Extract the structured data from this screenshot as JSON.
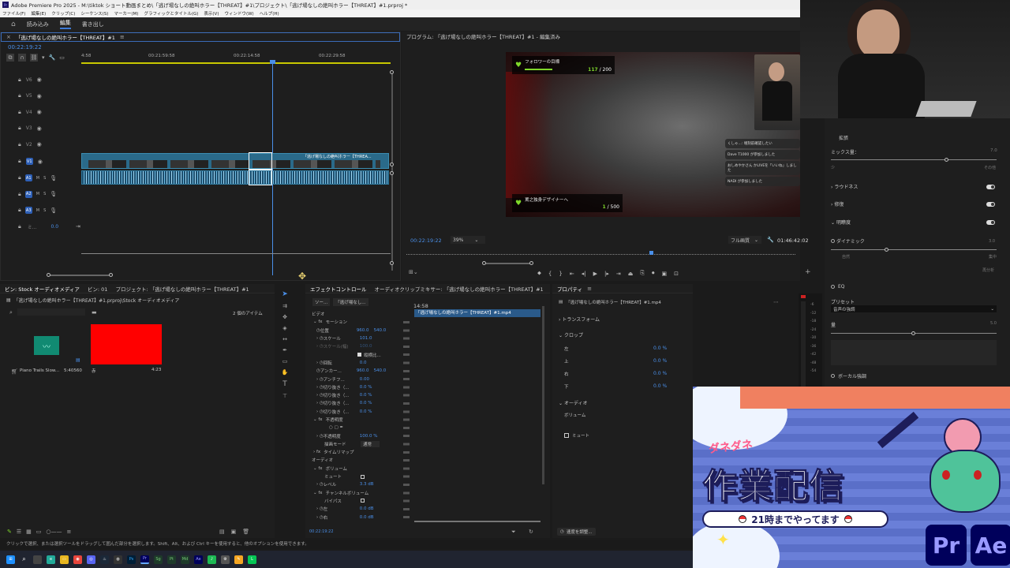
{
  "app": {
    "title": "Adobe Premiere Pro 2025 - M:\\tiktok ショート動画まとめ\\「逃げ場なしの絶叫ホラー【THREAT】#1\\プロジェクト\\「逃げ場なしの絶叫ホラー【THREAT】#1.prproj *"
  },
  "menu": [
    "ファイル(F)",
    "編集(E)",
    "クリップ(C)",
    "シーケンス(S)",
    "マーカー(M)",
    "グラフィックとタイトル(G)",
    "表示(V)",
    "ウィンドウ(W)",
    "ヘルプ(H)"
  ],
  "workspace": {
    "tabs": [
      "読み込み",
      "編集",
      "書き出し"
    ],
    "program_header": "プログラム: 「逃げ場なしの絶叫ホラー【THREAT】#1 - 編集済み"
  },
  "timeline": {
    "header": "「逃げ場なしの絶叫ホラー【THREAT】#1",
    "timecode": "00:22:19:22",
    "ruler": [
      "4:58",
      "00:21:59:58",
      "00:22:14:58",
      "00:22:29:58"
    ],
    "tracks": [
      {
        "id": "V6"
      },
      {
        "id": "V5"
      },
      {
        "id": "V4"
      },
      {
        "id": "V3"
      },
      {
        "id": "V2"
      },
      {
        "id": "V1"
      },
      {
        "id": "A1"
      },
      {
        "id": "A2"
      },
      {
        "id": "A3"
      }
    ],
    "mix_label": "ミ...",
    "mix_value": "0.0",
    "clip_label": "「逃げ場なしの絶叫ホラー【THREA..."
  },
  "program": {
    "timecode": "00:22:19:22",
    "zoom": "39%",
    "quality": "フル画質",
    "duration": "01:46:42:02",
    "overlay_top": {
      "label": "フォロワーの目標",
      "current": "117",
      "goal": "200"
    },
    "overlay_bottom": {
      "label": "罵之独身デザイナーへ",
      "current": "1",
      "goal": "500"
    },
    "chat": [
      "くしゃ...: 増刻前確認したい",
      "Dave T1000 が参加しました",
      "おしめやかさん かLIVEを「いいね」しました",
      "NADI が参加しました"
    ]
  },
  "source_panel": {
    "tabs": [
      "ビン: Stock オーディオメディア",
      "ビン: 01",
      "プロジェクト: 「逃げ場なしの絶叫ホラー【THREAT】#1",
      "オーディオクリップミキサー: 「逃げ場なしの絶叫ホラー【THREAT】#1"
    ],
    "path": "「逃げ場なしの絶叫ホラー【THREAT】#1.prproj\\Stock オーディオメディア",
    "item_count": "2 個のアイテム",
    "items": [
      {
        "name": "Piano Trails Slow...",
        "duration": "5:40560"
      },
      {
        "name": "赤",
        "duration": "4:23"
      }
    ]
  },
  "effects": {
    "tabs": [
      "ソー...",
      "「逃げ場なし..."
    ],
    "clip": "「逃げ場なしの絶叫ホラー【THREAT】#1.mp4",
    "mini_time": "14:58",
    "footer_time": "00:22:19:22",
    "sections": {
      "video": "ビデオ",
      "motion": "モーション",
      "opacity": "不透明度",
      "timeremap": "タイムリマップ",
      "audio": "オーディオ",
      "volume": "ボリューム",
      "channel_volume": "チャンネルボリューム"
    },
    "rows": [
      {
        "label": "位置",
        "v1": "960.0",
        "v2": "540.0"
      },
      {
        "label": "スケール",
        "v1": "101.0",
        "v2": ""
      },
      {
        "label": "スケール(幅)",
        "v1": "100.0",
        "v2": ""
      },
      {
        "label": "縦横比...",
        "v1": "",
        "v2": ""
      },
      {
        "label": "回転",
        "v1": "0.0",
        "v2": ""
      },
      {
        "label": "アンカー...",
        "v1": "960.0",
        "v2": "540.0"
      },
      {
        "label": "アンチフ...",
        "v1": "0.00",
        "v2": ""
      },
      {
        "label": "切り抜き（...",
        "v1": "0.0 %",
        "v2": ""
      },
      {
        "label": "切り抜き（...",
        "v1": "0.0 %",
        "v2": ""
      },
      {
        "label": "切り抜き（...",
        "v1": "0.0 %",
        "v2": ""
      },
      {
        "label": "切り抜き（...",
        "v1": "0.0 %",
        "v2": ""
      }
    ],
    "opacity_rows": [
      {
        "label": "不透明度",
        "v1": "100.0 %"
      },
      {
        "label": "描画モード",
        "v1": "通常"
      }
    ],
    "volume_rows": [
      {
        "label": "ミュート",
        "v1": ""
      },
      {
        "label": "レベル",
        "v1": "3.3 dB"
      }
    ],
    "channel_rows": [
      {
        "label": "バイパス",
        "v1": ""
      },
      {
        "label": "左",
        "v1": "0.0 dB"
      },
      {
        "label": "右",
        "v1": "0.0 dB"
      }
    ]
  },
  "properties": {
    "title": "プロパティ",
    "clip": "「逃げ場なしの絶叫ホラー【THREAT】#1.mp4",
    "transform": "トランスフォーム",
    "crop": "クロップ",
    "crop_rows": [
      {
        "label": "左",
        "value": "0.0 %"
      },
      {
        "label": "上",
        "value": "0.0 %"
      },
      {
        "label": "右",
        "value": "0.0 %"
      },
      {
        "label": "下",
        "value": "0.0 %"
      }
    ],
    "audio": "オーディオ",
    "volume": "ボリューム",
    "mute": "ミュート",
    "speed_btn": "速度を調整..."
  },
  "essential_sound": {
    "expand": "拡張",
    "mix": "ミックス量：",
    "mix_value": "7.0",
    "mix_min": "少",
    "mix_max": "その他",
    "loudness": "ラウドネス",
    "repair": "修復",
    "clarity": "明瞭度",
    "dynamics": "ダイナミック",
    "dyn_value": "3.0",
    "dyn_min": "自然",
    "dyn_max": "集中",
    "reset": "再分析",
    "eq": "EQ",
    "preset_label": "プリセット",
    "preset_value": "音声の強調",
    "amount": "量",
    "amount_value": "5.0",
    "vocal": "ボーカル強調"
  },
  "statusbar": "クリックで選択、または選択ツールをドラッグして囲んだ部分を選択します。Shift、Alt、および Ctrl キーを使用すると、他のオプションを使用できます。",
  "banner": {
    "kana": "ダネダネ",
    "main": "作業配信",
    "sub": "21時までやってます",
    "pr": "Pr",
    "ae": "Ae"
  },
  "colors": {
    "accent": "#3e7bd8",
    "clip_blue": "#2a6a8a",
    "red": "#ff0000",
    "banner_blue": "#5a6fc8"
  }
}
